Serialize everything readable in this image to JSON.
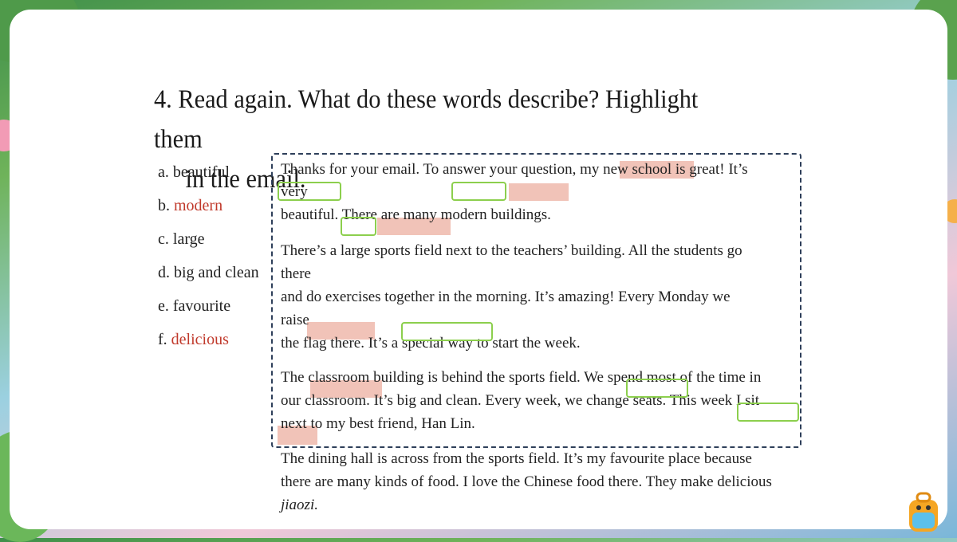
{
  "title": {
    "line1": "4. Read again. What do these words describe? Highlight them",
    "line2": "in the email."
  },
  "words": [
    {
      "letter": "a.",
      "word": "beautiful",
      "highlight": false
    },
    {
      "letter": "b.",
      "word": "modern",
      "highlight": true
    },
    {
      "letter": "c.",
      "word": "large",
      "highlight": false
    },
    {
      "letter": "d.",
      "word": "big and clean",
      "highlight": false
    },
    {
      "letter": "e.",
      "word": "favourite",
      "highlight": false
    },
    {
      "letter": "f.",
      "word": "delicious",
      "highlight": true
    }
  ],
  "email_lines": [
    "Thanks for your email. To answer your question, my new school is great! It’s",
    "very",
    "beautiful. There are many modern buildings.",
    "There’s a large sports field next to the teachers’ building. All the students go",
    "there",
    "and do exercises together in the morning. It’s amazing! Every Monday we",
    "raise",
    "the flag there. It’s a special way to start the week.",
    "The classroom building is behind the sports field. We spend most of the time in",
    "our classroom. It’s big and clean. Every week, we change seats. This week I sit",
    "next to my best friend, Han Lin."
  ],
  "below_lines": [
    "The dining hall is across from the sports field. It’s my favourite place because",
    "there are many kinds of food. I love the Chinese food there. They make delicious",
    "jiaozi."
  ],
  "colors": {
    "highlight_red": "#eeb8ab",
    "highlight_green": "#8ccf4d",
    "word_red": "#c0392b",
    "dashed_border": "#2e3f5a"
  }
}
